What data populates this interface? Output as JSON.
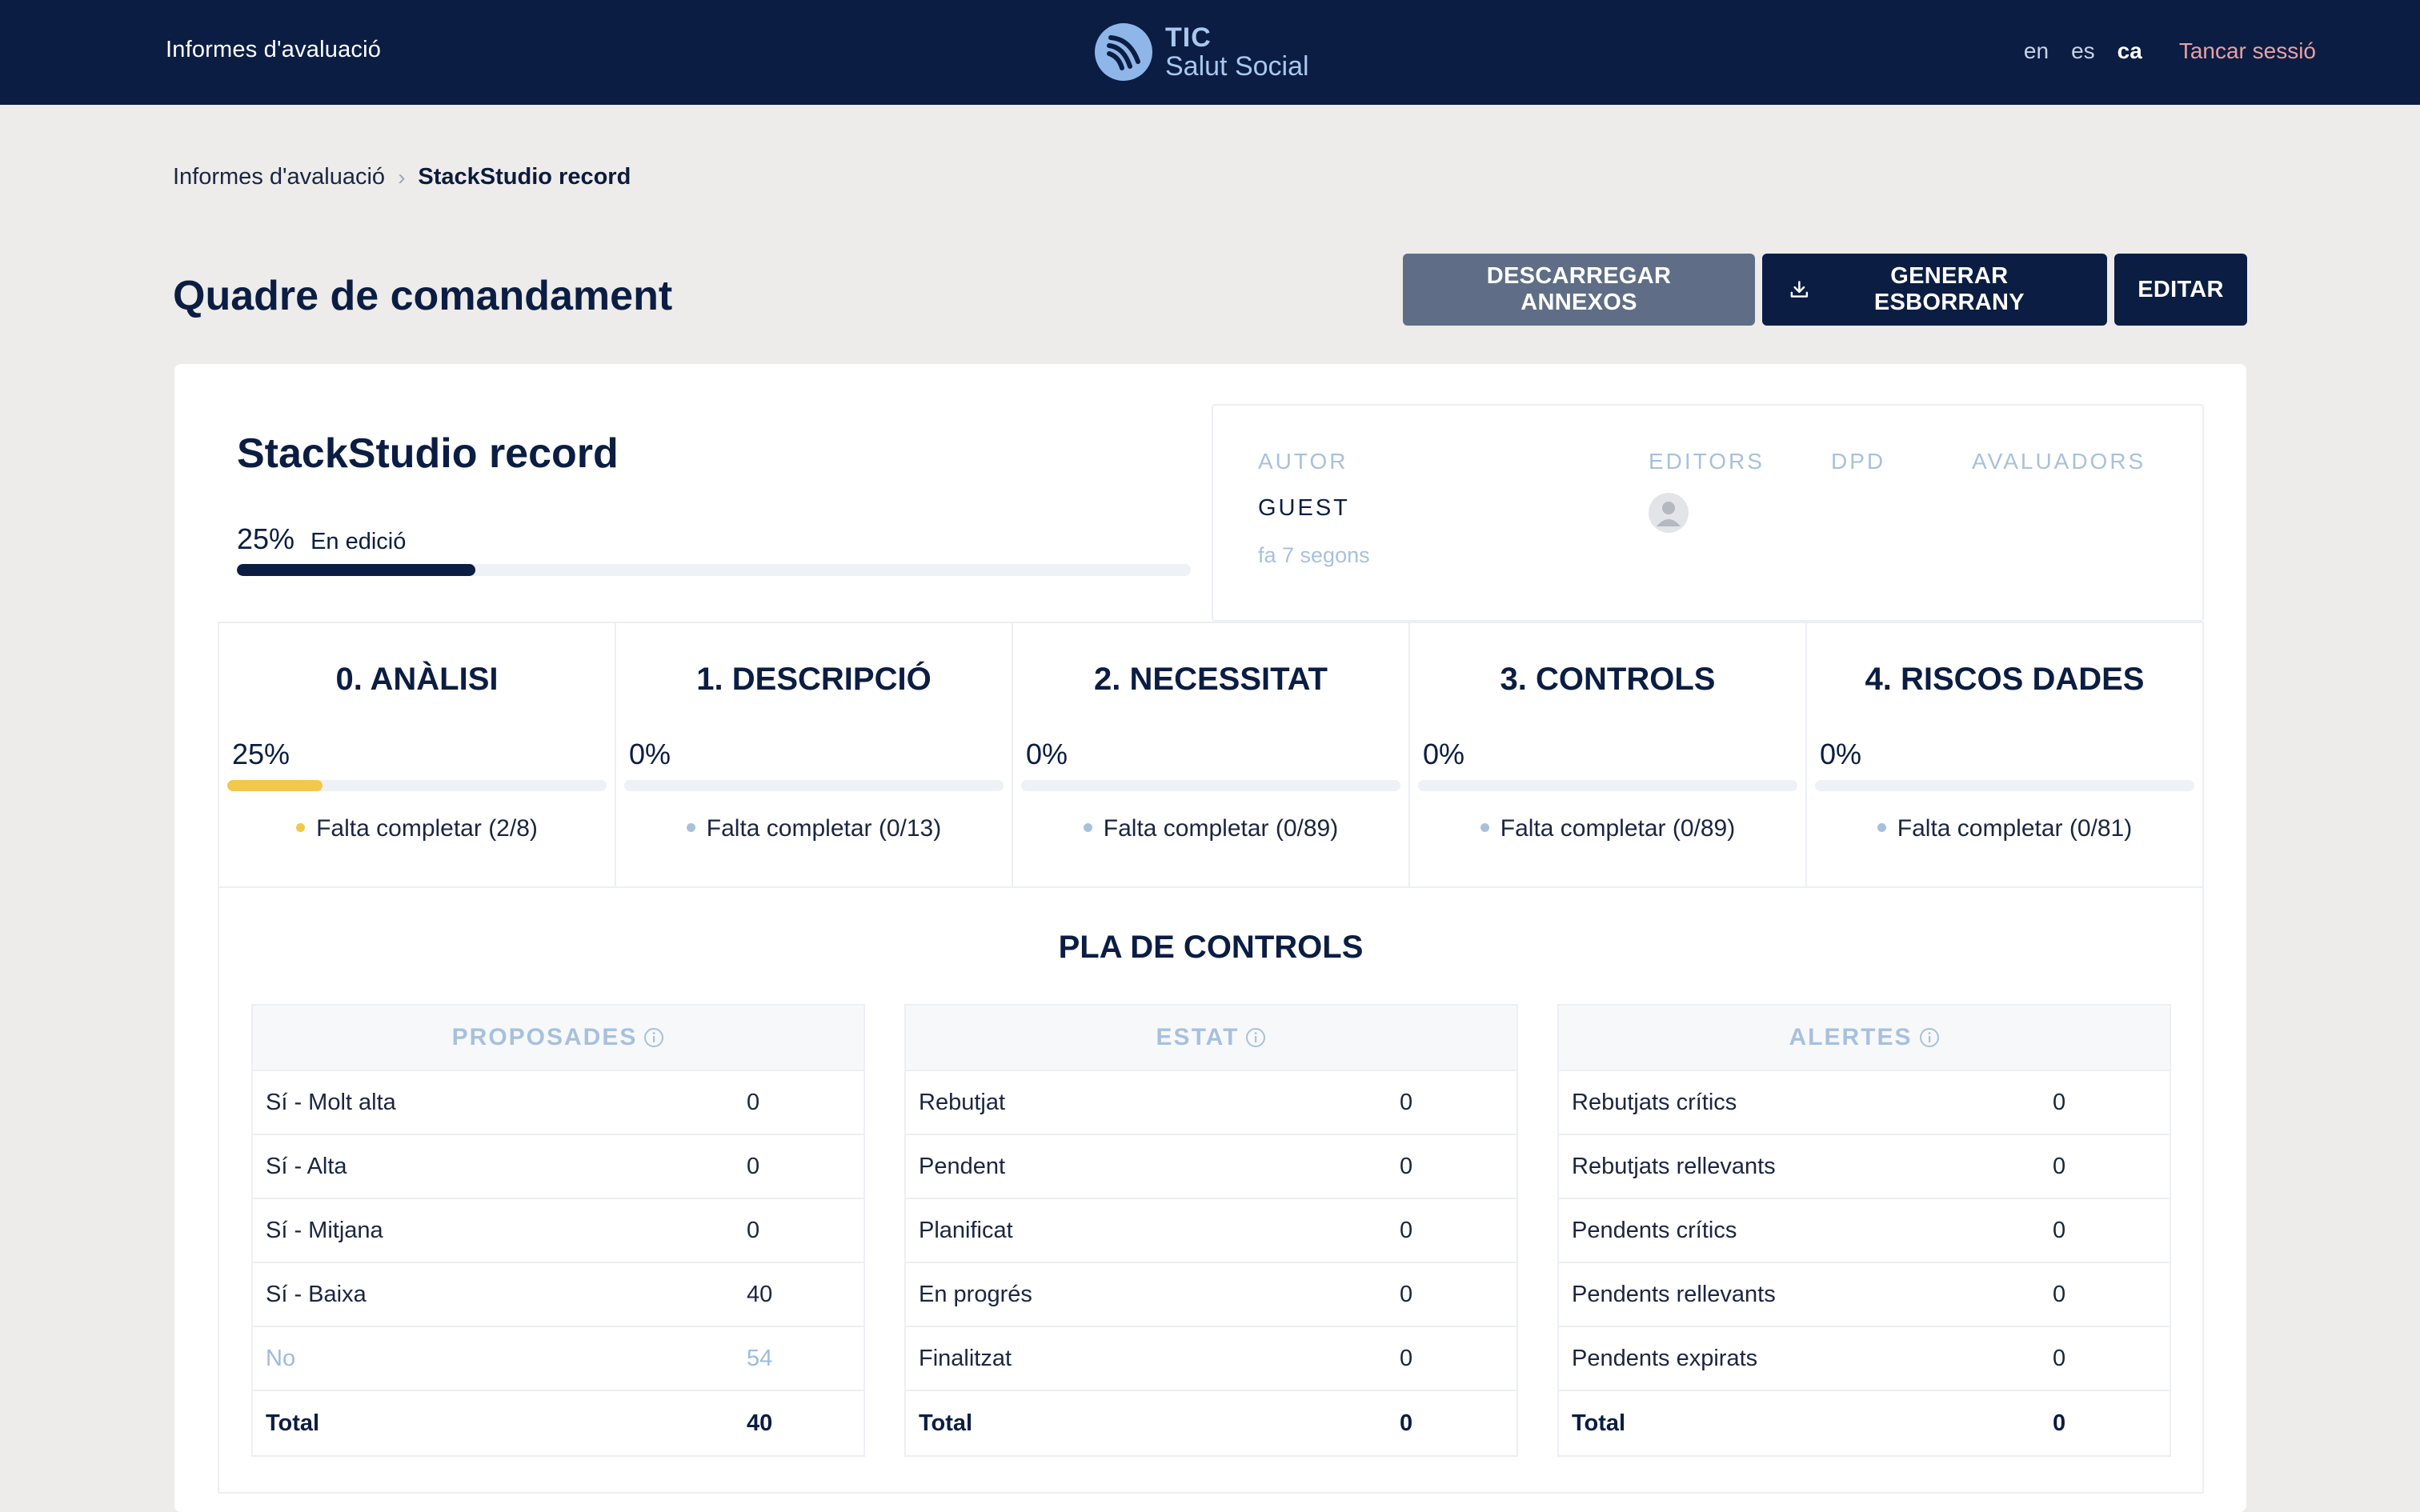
{
  "topbar": {
    "app_title": "Informes d'avaluació",
    "brand_line1": "TIC",
    "brand_line2": "Salut Social",
    "langs": [
      "en",
      "es",
      "ca"
    ],
    "active_lang": "ca",
    "logout": "Tancar sessió"
  },
  "breadcrumb": {
    "parent": "Informes d'avaluació",
    "separator": "›",
    "current": "StackStudio record"
  },
  "page": {
    "title": "Quadre de comandament",
    "buttons": {
      "download": "DESCARREGAR ANNEXOS",
      "generate": "GENERAR ESBORRANY",
      "edit": "EDITAR"
    }
  },
  "report": {
    "name": "StackStudio record",
    "progress_label": "25%",
    "progress_value": 0.25,
    "status": "En edició"
  },
  "people": {
    "author_head": "AUTOR",
    "editors_head": "EDITORS",
    "dpd_head": "DPD",
    "evaluators_head": "AVALUADORS",
    "author_name": "GUEST",
    "author_time": "fa 7 segons"
  },
  "sections": [
    {
      "title": "0. ANÀLISI",
      "pct": "25%",
      "value": 0.25,
      "note": "Falta completar (2/8)",
      "dot_color": "#f1c84a"
    },
    {
      "title": "1. DESCRIPCIÓ",
      "pct": "0%",
      "value": 0,
      "note": "Falta completar (0/13)",
      "dot_color": "#a7c1dc"
    },
    {
      "title": "2. NECESSITAT",
      "pct": "0%",
      "value": 0,
      "note": "Falta completar (0/89)",
      "dot_color": "#a7c1dc"
    },
    {
      "title": "3. CONTROLS",
      "pct": "0%",
      "value": 0,
      "note": "Falta completar (0/89)",
      "dot_color": "#a7c1dc"
    },
    {
      "title": "4. RISCOS DADES",
      "pct": "0%",
      "value": 0,
      "note": "Falta completar (0/81)",
      "dot_color": "#a7c1dc"
    }
  ],
  "plan": {
    "title": "PLA DE CONTROLS",
    "tables": [
      {
        "header": "PROPOSADES",
        "rows": [
          {
            "label": "Sí - Molt alta",
            "value": "0"
          },
          {
            "label": "Sí - Alta",
            "value": "0"
          },
          {
            "label": "Sí - Mitjana",
            "value": "0"
          },
          {
            "label": "Sí - Baixa",
            "value": "40"
          },
          {
            "label": "No",
            "value": "54"
          },
          {
            "label": "Total",
            "value": "40"
          }
        ]
      },
      {
        "header": "ESTAT",
        "rows": [
          {
            "label": "Rebutjat",
            "value": "0"
          },
          {
            "label": "Pendent",
            "value": "0"
          },
          {
            "label": "Planificat",
            "value": "0"
          },
          {
            "label": "En progrés",
            "value": "0"
          },
          {
            "label": "Finalitzat",
            "value": "0"
          },
          {
            "label": "Total",
            "value": "0"
          }
        ]
      },
      {
        "header": "ALERTES",
        "rows": [
          {
            "label": "Rebutjats crítics",
            "value": "0"
          },
          {
            "label": "Rebutjats rellevants",
            "value": "0"
          },
          {
            "label": "Pendents crítics",
            "value": "0"
          },
          {
            "label": "Pendents rellevants",
            "value": "0"
          },
          {
            "label": "Pendents expirats",
            "value": "0"
          },
          {
            "label": "Total",
            "value": "0"
          }
        ]
      }
    ]
  },
  "colors": {
    "navy": "#0b1d42",
    "accent_yellow": "#f1c84a",
    "muted_blue": "#a7c1dc",
    "logout_pink": "#e8a0a6"
  }
}
